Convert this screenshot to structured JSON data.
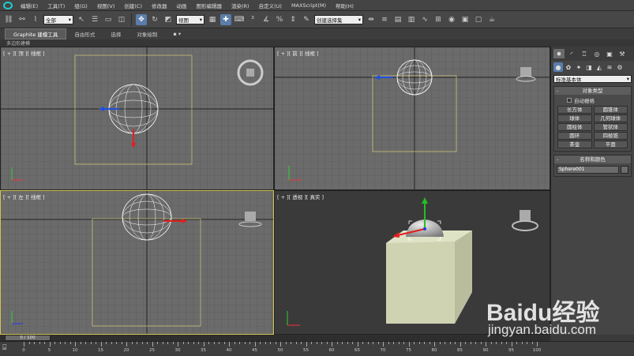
{
  "menubar": {
    "items": [
      "编辑(E)",
      "工具(T)",
      "组(G)",
      "视图(V)",
      "创建(C)",
      "修改器",
      "动画",
      "图形编辑器",
      "渲染(R)",
      "自定义(U)",
      "MAXScript(M)",
      "帮助(H)"
    ]
  },
  "toolbar": {
    "selection_filter": "全部",
    "ref_coord": "视图",
    "named_selection": "创建选择集"
  },
  "ribbon": {
    "tabs": [
      "Graphite 建模工具",
      "自由形式",
      "选择",
      "对象绘制"
    ],
    "subtitle": "多边形建模"
  },
  "viewports": {
    "top": "[ + ][ 顶 ][ 线框 ]",
    "front": "[ + ][ 前 ][ 线框 ]",
    "left": "[ + ][ 左 ][ 线框 ]",
    "persp": "[ + ][ 透视 ][ 真实 ]"
  },
  "cmdpanel": {
    "dropdown": "标准基本体",
    "object_type_title": "对象类型",
    "autogrid": "自动栅格",
    "buttons": [
      "长方体",
      "圆锥体",
      "球体",
      "几何球体",
      "圆柱体",
      "管状体",
      "圆环",
      "四棱锥",
      "茶壶",
      "平面"
    ],
    "name_color_title": "名称和颜色",
    "name_value": "Sphere001"
  },
  "timeline": {
    "slider": "0 / 100",
    "ticks": [
      "0",
      "5",
      "10",
      "15",
      "20",
      "25",
      "30",
      "35",
      "40",
      "45",
      "50",
      "55",
      "60",
      "65",
      "70",
      "75",
      "80",
      "85",
      "90",
      "95",
      "100"
    ]
  },
  "watermark": {
    "brand": "Baidu经验",
    "url": "jingyan.baidu.com"
  }
}
